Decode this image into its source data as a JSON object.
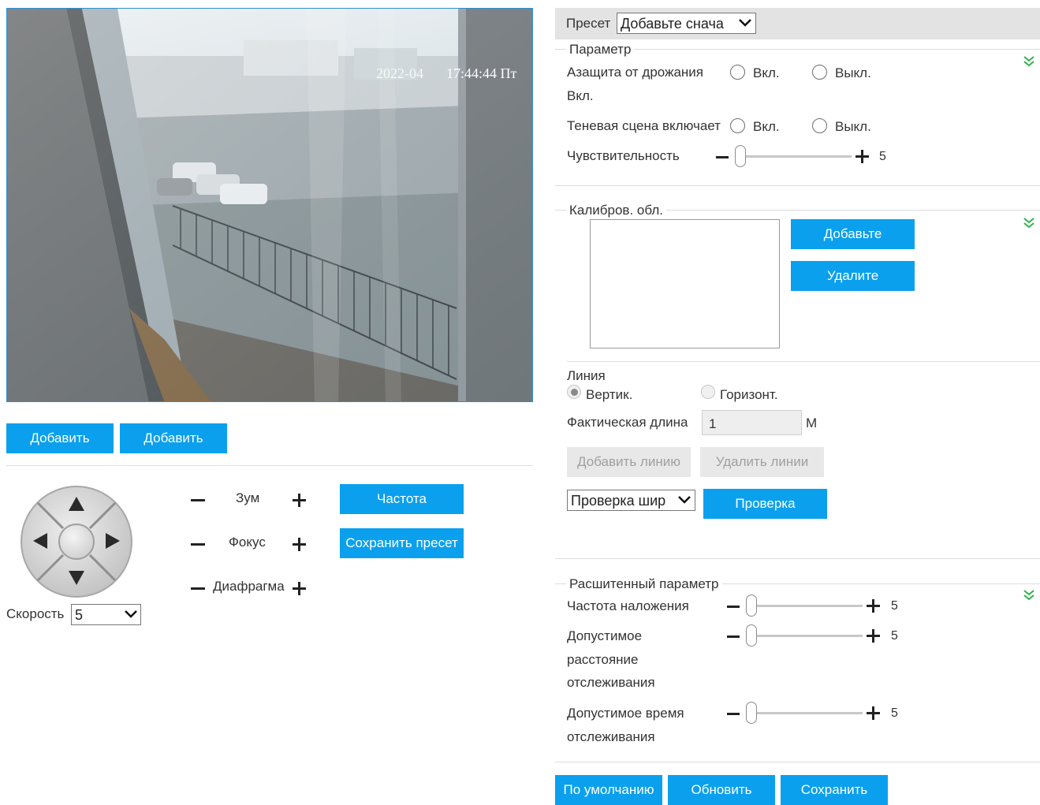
{
  "video": {
    "overlay_time": "17:44:44 Пт",
    "overlay_date": "2022-04"
  },
  "left_buttons": {
    "add1": "Добавить",
    "add2": "Добавить"
  },
  "ptz": {
    "zoom_label": "Зум",
    "focus_label": "Фокус",
    "iris_label": "Диафрагма",
    "frequency_button": "Частота",
    "save_preset_button": "Сохранить пресет",
    "speed_label": "Скорость",
    "speed_value": "5"
  },
  "preset": {
    "label": "Пресет",
    "value": "Добавьте снача"
  },
  "params": {
    "legend": "Параметр",
    "antishake_label_1": "Азащита от дрожания",
    "antishake_label_2": "Вкл.",
    "shadow_label": "Теневая сцена включает",
    "on_label": "Вкл.",
    "off_label": "Выкл.",
    "sensitivity_label": "Чувствительность",
    "sensitivity_value": "5",
    "sensitivity_level": 0.05
  },
  "calibration": {
    "legend": "Калибров. обл.",
    "add_button": "Добавьте",
    "delete_button": "Удалите",
    "line_label": "Линия",
    "vertical_label": "Вертик.",
    "horizontal_label": "Горизонт.",
    "length_label": "Фактическая длина",
    "length_value": "1",
    "unit": "M",
    "add_line_button": "Добавить линию",
    "delete_lines_button": "Удалить линии",
    "check_select": "Проверка шир",
    "check_button": "Проверка"
  },
  "advanced": {
    "legend": "Расшитенный параметр",
    "overlap_label": "Частота наложения",
    "overlap_value": "5",
    "distance_label_1": "Допустимое",
    "distance_label_2": "расстояние",
    "distance_label_3": "отслеживания",
    "distance_value": "5",
    "time_label_1": "Допустимое время",
    "time_label_2": "отслеживания",
    "time_value": "5",
    "level": 0.05
  },
  "footer": {
    "default_button": "По умолчанию",
    "refresh_button": "Обновить",
    "save_button": "Сохранить"
  },
  "colors": {
    "accent": "#0aa0ee",
    "header_bg": "#e3e3e3",
    "chevron": "#2db34a"
  }
}
